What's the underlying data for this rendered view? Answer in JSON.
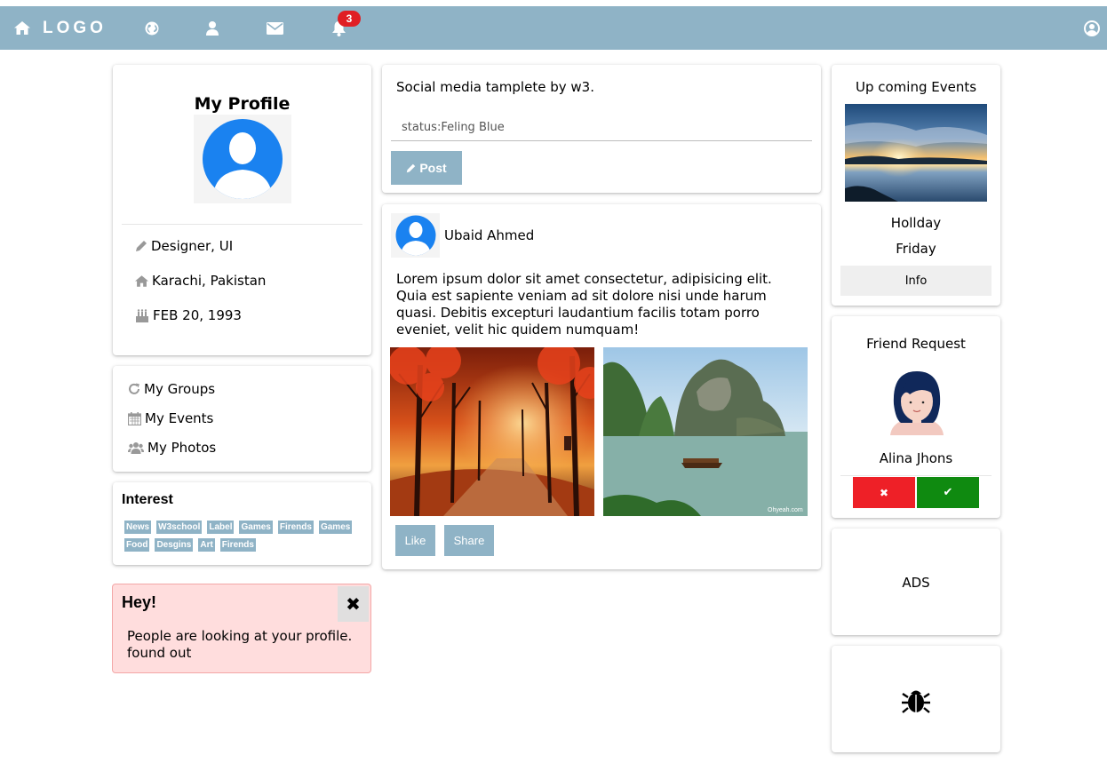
{
  "navbar": {
    "logo_text": "LOGO",
    "notification_count": "3",
    "bar_color": "#8fb3c6",
    "icons": [
      "home-icon",
      "globe-icon",
      "user-icon",
      "envelope-icon",
      "bell-icon",
      "account-icon"
    ]
  },
  "profile": {
    "title": "My Profile",
    "job": "Designer, UI",
    "location": "Karachi, Pakistan",
    "birthday": "FEB 20, 1993"
  },
  "links": {
    "groups": "My Groups",
    "events": "My Events",
    "photos": "My Photos"
  },
  "interest": {
    "title": "Interest",
    "tags": [
      "News",
      "W3school",
      "Label",
      "Games",
      "Firends",
      "Games",
      "Food",
      "Desgins",
      "Art",
      "Firends"
    ]
  },
  "alert": {
    "title": "Hey!",
    "close": "✖",
    "message": "People are looking at your profile. found out"
  },
  "composer": {
    "heading": "Social media tamplete by w3.",
    "status_value": "status:Feling Blue",
    "post_label": "Post"
  },
  "feed_post": {
    "author": "Ubaid Ahmed",
    "text": "Lorem ipsum dolor sit amet consectetur, adipisicing elit. Quia est sapiente veniam ad sit dolore nisi unde harum quasi. Debitis excepturi laudantium facilis totam porro eveniet, velit hic quidem numquam!",
    "like_label": "Like",
    "share_label": "Share"
  },
  "events": {
    "title": "Up coming Events",
    "line1": "Hollday",
    "line2": "Friday",
    "info_label": "Info"
  },
  "friend_request": {
    "title": "Friend Request",
    "name": "Alina Jhons",
    "decline_symbol": "✖",
    "accept_symbol": "✔",
    "decline_color": "#ee2027",
    "accept_color": "#0f8a10"
  },
  "ads": {
    "label": "ADS"
  },
  "bug": {
    "icon": "bug-icon"
  }
}
